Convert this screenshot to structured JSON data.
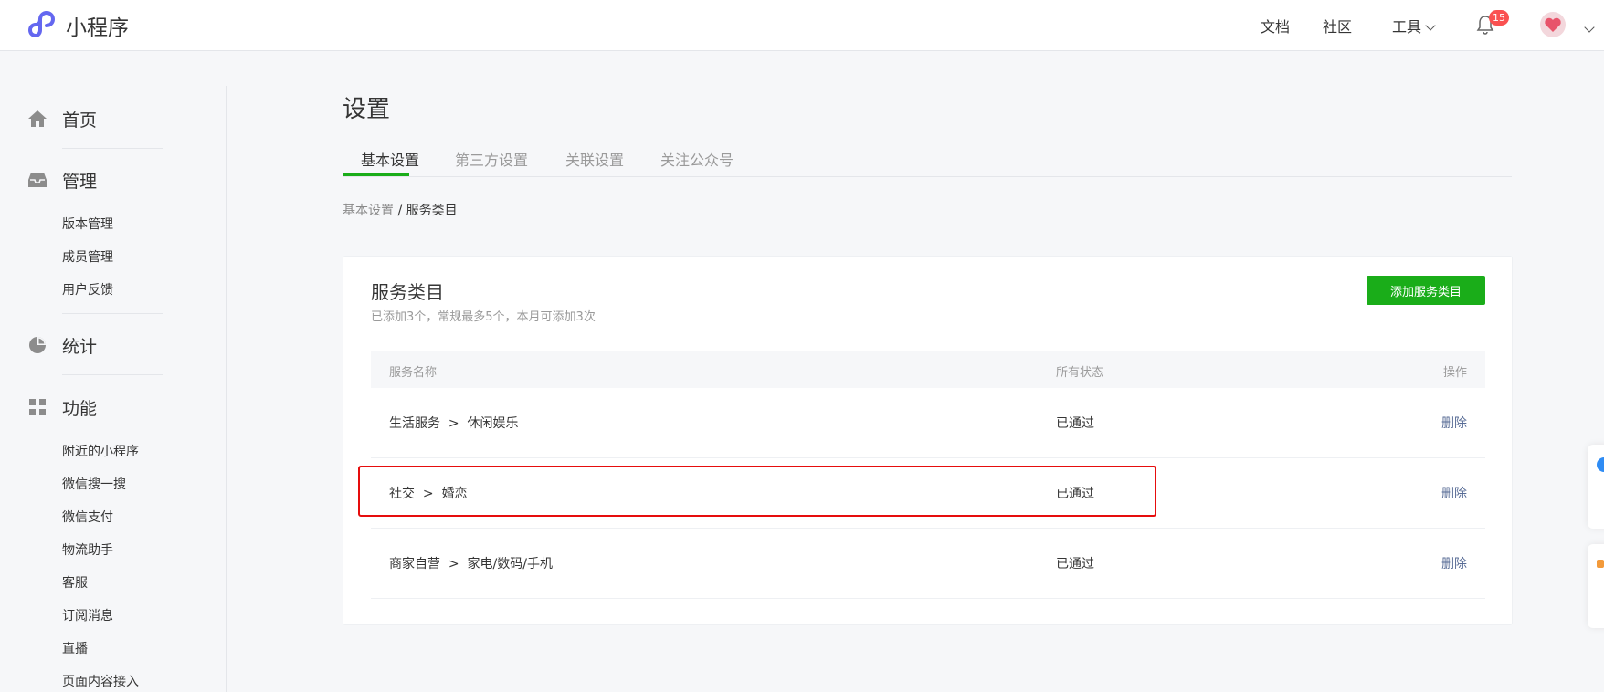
{
  "app": {
    "name": "小程序"
  },
  "topnav": {
    "docs": "文档",
    "community": "社区",
    "tools": "工具",
    "notification_count": "15"
  },
  "sidebar": {
    "home": "首页",
    "manage": "管理",
    "manage_items": [
      "版本管理",
      "成员管理",
      "用户反馈"
    ],
    "stats": "统计",
    "features": "功能",
    "feature_items": [
      "附近的小程序",
      "微信搜一搜",
      "微信支付",
      "物流助手",
      "客服",
      "订阅消息",
      "直播",
      "页面内容接入"
    ]
  },
  "page": {
    "title": "设置",
    "tabs": [
      "基本设置",
      "第三方设置",
      "关联设置",
      "关注公众号"
    ],
    "active_tab": 0,
    "breadcrumb": {
      "parent": "基本设置",
      "separator": "/",
      "current": "服务类目"
    }
  },
  "card": {
    "title": "服务类目",
    "subtitle": "已添加3个，常规最多5个，本月可添加3次",
    "add_button": "添加服务类目",
    "columns": [
      "服务名称",
      "所有状态",
      "操作"
    ],
    "rows": [
      {
        "category": "生活服务",
        "sep": ">",
        "sub": "休闲娱乐",
        "status": "已通过",
        "action": "删除"
      },
      {
        "category": "社交",
        "sep": ">",
        "sub": "婚恋",
        "status": "已通过",
        "action": "删除"
      },
      {
        "category": "商家自营",
        "sep": ">",
        "sub": "家电/数码/手机",
        "status": "已通过",
        "action": "删除"
      }
    ]
  },
  "colors": {
    "brand_green": "#1aad19",
    "link_blue": "#576b95",
    "badge_red": "#fa5151",
    "highlight_red": "#e60d0d"
  }
}
